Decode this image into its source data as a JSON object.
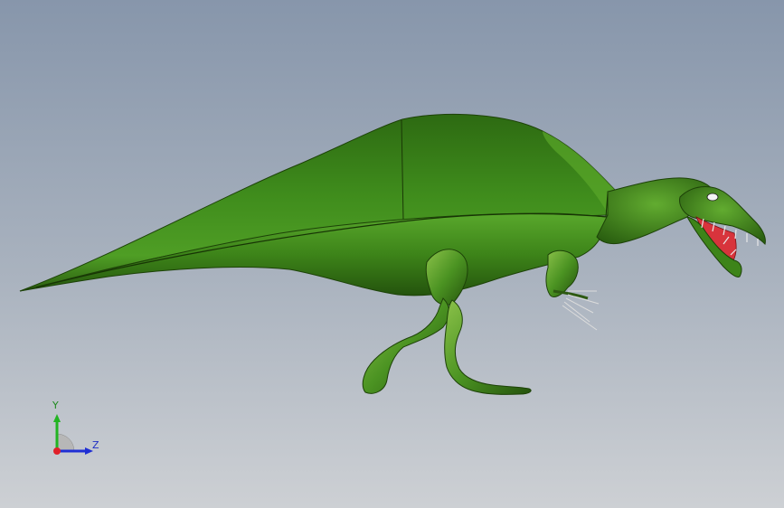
{
  "viewport": {
    "background_top": "#8796ab",
    "background_bottom": "#cdd0d4"
  },
  "model": {
    "subject": "spinosaurus-model",
    "body_color": "#2f6b14",
    "highlight_color": "#7fb53a",
    "mouth_color": "#d8343c"
  },
  "triad": {
    "y_label": "Y",
    "z_label": "Z",
    "y_color": "#22b422",
    "z_color": "#1f2fd4",
    "x_color": "#e0202a"
  }
}
